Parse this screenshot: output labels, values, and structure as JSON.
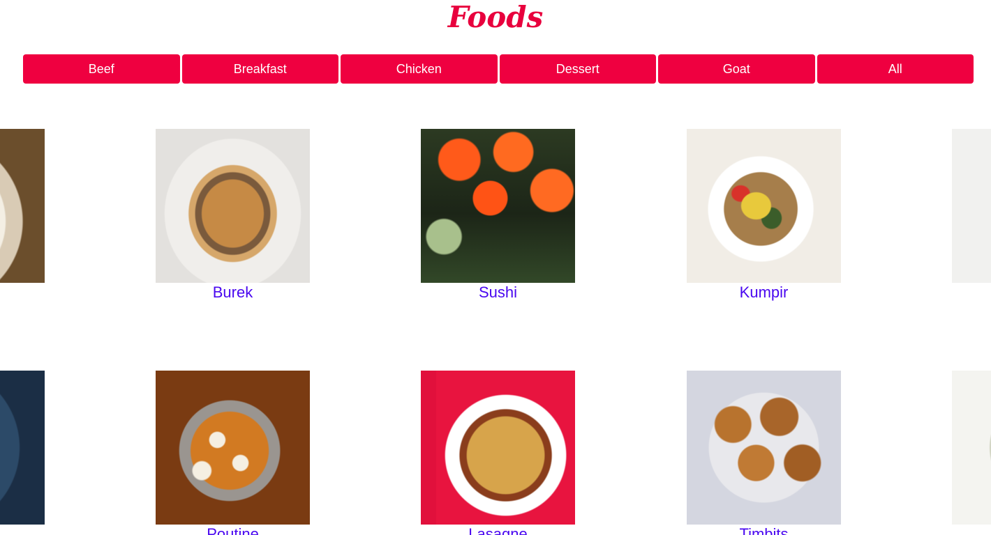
{
  "page": {
    "title": "Foods"
  },
  "filters": [
    {
      "label": "Beef"
    },
    {
      "label": "Breakfast"
    },
    {
      "label": "Chicken"
    },
    {
      "label": "Dessert"
    },
    {
      "label": "Goat"
    },
    {
      "label": "All"
    }
  ],
  "foods": [
    {
      "name": "",
      "image": "soup-photo"
    },
    {
      "name": "Burek",
      "image": "burek-photo"
    },
    {
      "name": "Sushi",
      "image": "sushi-photo"
    },
    {
      "name": "Kumpir",
      "image": "kumpir-photo"
    },
    {
      "name": "",
      "image": "falafel-photo"
    },
    {
      "name": "",
      "image": "curry-photo"
    },
    {
      "name": "Poutine",
      "image": "poutine-photo"
    },
    {
      "name": "Lasagne",
      "image": "lasagne-photo"
    },
    {
      "name": "Timbits",
      "image": "timbits-photo"
    },
    {
      "name": "",
      "image": "dumpling-photo"
    }
  ],
  "colors": {
    "title": "#e8003d",
    "button_bg": "#ef0040",
    "button_text": "#ffffff",
    "link": "#4a08f0"
  }
}
